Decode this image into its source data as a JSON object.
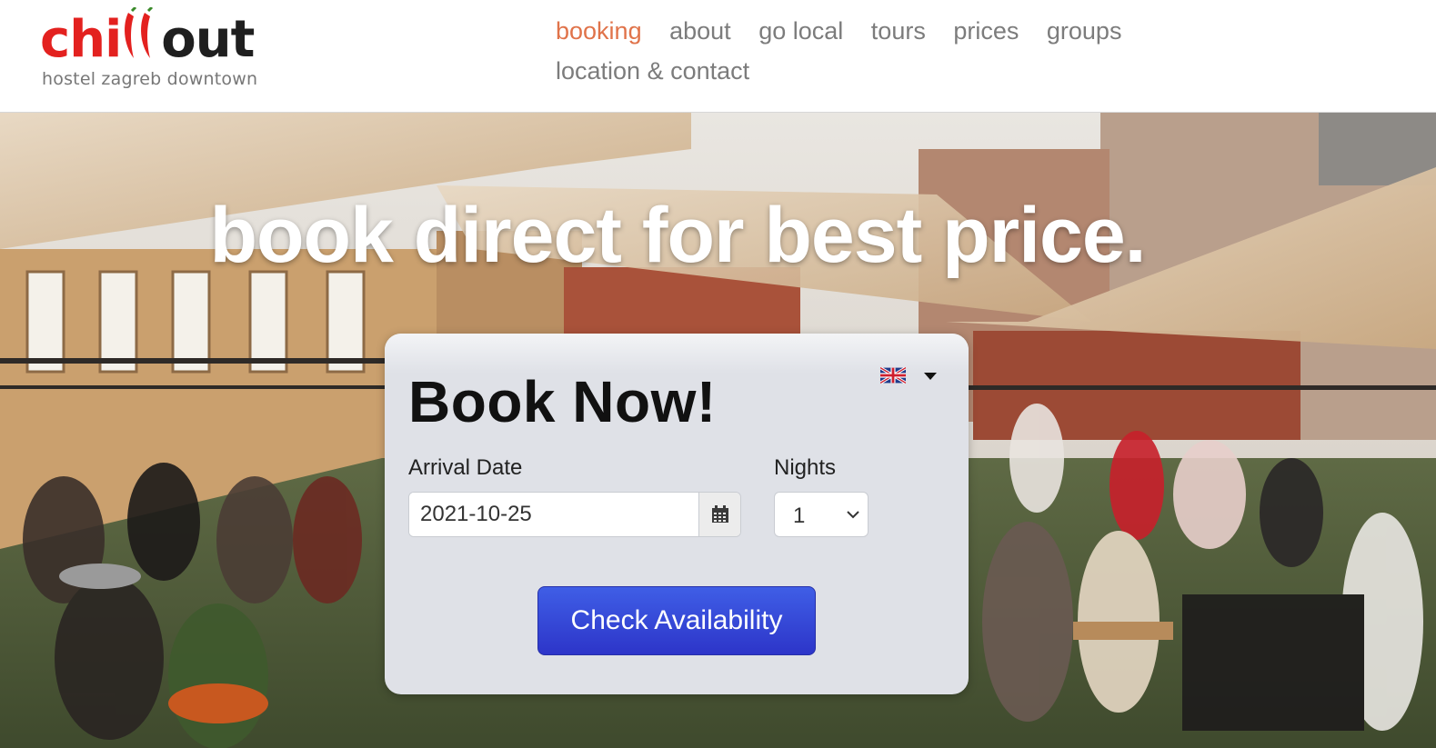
{
  "logo": {
    "brand_left": "chi",
    "brand_right": "out",
    "subtitle": "hostel zagreb downtown",
    "accent_color": "#e3211f"
  },
  "nav": {
    "items": [
      {
        "label": "booking",
        "active": true
      },
      {
        "label": "about"
      },
      {
        "label": "go local"
      },
      {
        "label": "tours"
      },
      {
        "label": "prices"
      },
      {
        "label": "groups"
      },
      {
        "label": "location & contact"
      }
    ],
    "active_color": "#e0734a"
  },
  "hero": {
    "headline": "book direct for best price."
  },
  "booking": {
    "title": "Book Now!",
    "language_icon": "uk-flag-icon",
    "arrival_label": "Arrival Date",
    "arrival_value": "2021-10-25",
    "calendar_icon": "calendar-icon",
    "nights_label": "Nights",
    "nights_value": "1",
    "check_button": "Check Availability",
    "button_color": "#3447d6"
  }
}
